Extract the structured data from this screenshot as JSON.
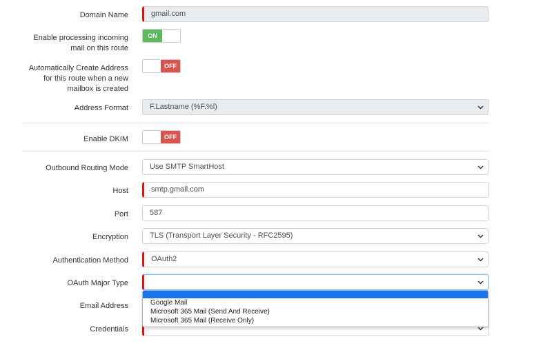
{
  "form": {
    "domain_name": {
      "label": "Domain Name",
      "value": "gmail.com"
    },
    "enable_processing": {
      "label": "Enable processing incoming mail on this route",
      "state": "ON"
    },
    "auto_create": {
      "label": "Automatically Create Address for this route when a new mailbox is created",
      "state": "OFF"
    },
    "address_format": {
      "label": "Address Format",
      "value": "F.Lastname (%F.%l)"
    },
    "enable_dkim": {
      "label": "Enable DKIM",
      "state": "OFF"
    },
    "outbound_routing": {
      "label": "Outbound Routing Mode",
      "value": "Use SMTP SmartHost"
    },
    "host": {
      "label": "Host",
      "value": "smtp.gmail.com"
    },
    "port": {
      "label": "Port",
      "value": "587"
    },
    "encryption": {
      "label": "Encryption",
      "value": "TLS (Transport Layer Security - RFC2595)"
    },
    "auth_method": {
      "label": "Authentication Method",
      "value": "OAuth2"
    },
    "oauth_major_type": {
      "label": "OAuth Major Type",
      "value": "",
      "options": [
        "",
        "Google Mail",
        "Microsoft 365 Mail (Send And Receive)",
        "Microsoft 365 Mail (Receive Only)"
      ]
    },
    "email_address": {
      "label": "Email Address"
    },
    "credentials": {
      "label": "Credentials"
    }
  },
  "colors": {
    "required_marker": "#d9160f",
    "toggle_on": "#5cb85c",
    "toggle_off": "#d9534f",
    "dropdown_highlight": "#1a73e8"
  },
  "icons": {
    "select_arrow": "chevron-down-icon"
  }
}
